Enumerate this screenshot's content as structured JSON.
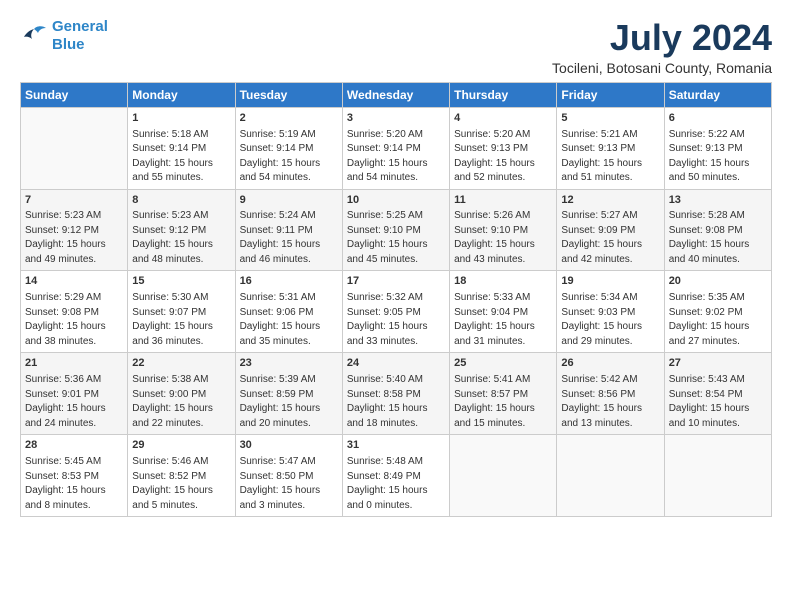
{
  "logo": {
    "line1": "General",
    "line2": "Blue"
  },
  "title": "July 2024",
  "subtitle": "Tocileni, Botosani County, Romania",
  "days_header": [
    "Sunday",
    "Monday",
    "Tuesday",
    "Wednesday",
    "Thursday",
    "Friday",
    "Saturday"
  ],
  "weeks": [
    [
      {
        "day": "",
        "content": ""
      },
      {
        "day": "1",
        "content": "Sunrise: 5:18 AM\nSunset: 9:14 PM\nDaylight: 15 hours\nand 55 minutes."
      },
      {
        "day": "2",
        "content": "Sunrise: 5:19 AM\nSunset: 9:14 PM\nDaylight: 15 hours\nand 54 minutes."
      },
      {
        "day": "3",
        "content": "Sunrise: 5:20 AM\nSunset: 9:14 PM\nDaylight: 15 hours\nand 54 minutes."
      },
      {
        "day": "4",
        "content": "Sunrise: 5:20 AM\nSunset: 9:13 PM\nDaylight: 15 hours\nand 52 minutes."
      },
      {
        "day": "5",
        "content": "Sunrise: 5:21 AM\nSunset: 9:13 PM\nDaylight: 15 hours\nand 51 minutes."
      },
      {
        "day": "6",
        "content": "Sunrise: 5:22 AM\nSunset: 9:13 PM\nDaylight: 15 hours\nand 50 minutes."
      }
    ],
    [
      {
        "day": "7",
        "content": "Sunrise: 5:23 AM\nSunset: 9:12 PM\nDaylight: 15 hours\nand 49 minutes."
      },
      {
        "day": "8",
        "content": "Sunrise: 5:23 AM\nSunset: 9:12 PM\nDaylight: 15 hours\nand 48 minutes."
      },
      {
        "day": "9",
        "content": "Sunrise: 5:24 AM\nSunset: 9:11 PM\nDaylight: 15 hours\nand 46 minutes."
      },
      {
        "day": "10",
        "content": "Sunrise: 5:25 AM\nSunset: 9:10 PM\nDaylight: 15 hours\nand 45 minutes."
      },
      {
        "day": "11",
        "content": "Sunrise: 5:26 AM\nSunset: 9:10 PM\nDaylight: 15 hours\nand 43 minutes."
      },
      {
        "day": "12",
        "content": "Sunrise: 5:27 AM\nSunset: 9:09 PM\nDaylight: 15 hours\nand 42 minutes."
      },
      {
        "day": "13",
        "content": "Sunrise: 5:28 AM\nSunset: 9:08 PM\nDaylight: 15 hours\nand 40 minutes."
      }
    ],
    [
      {
        "day": "14",
        "content": "Sunrise: 5:29 AM\nSunset: 9:08 PM\nDaylight: 15 hours\nand 38 minutes."
      },
      {
        "day": "15",
        "content": "Sunrise: 5:30 AM\nSunset: 9:07 PM\nDaylight: 15 hours\nand 36 minutes."
      },
      {
        "day": "16",
        "content": "Sunrise: 5:31 AM\nSunset: 9:06 PM\nDaylight: 15 hours\nand 35 minutes."
      },
      {
        "day": "17",
        "content": "Sunrise: 5:32 AM\nSunset: 9:05 PM\nDaylight: 15 hours\nand 33 minutes."
      },
      {
        "day": "18",
        "content": "Sunrise: 5:33 AM\nSunset: 9:04 PM\nDaylight: 15 hours\nand 31 minutes."
      },
      {
        "day": "19",
        "content": "Sunrise: 5:34 AM\nSunset: 9:03 PM\nDaylight: 15 hours\nand 29 minutes."
      },
      {
        "day": "20",
        "content": "Sunrise: 5:35 AM\nSunset: 9:02 PM\nDaylight: 15 hours\nand 27 minutes."
      }
    ],
    [
      {
        "day": "21",
        "content": "Sunrise: 5:36 AM\nSunset: 9:01 PM\nDaylight: 15 hours\nand 24 minutes."
      },
      {
        "day": "22",
        "content": "Sunrise: 5:38 AM\nSunset: 9:00 PM\nDaylight: 15 hours\nand 22 minutes."
      },
      {
        "day": "23",
        "content": "Sunrise: 5:39 AM\nSunset: 8:59 PM\nDaylight: 15 hours\nand 20 minutes."
      },
      {
        "day": "24",
        "content": "Sunrise: 5:40 AM\nSunset: 8:58 PM\nDaylight: 15 hours\nand 18 minutes."
      },
      {
        "day": "25",
        "content": "Sunrise: 5:41 AM\nSunset: 8:57 PM\nDaylight: 15 hours\nand 15 minutes."
      },
      {
        "day": "26",
        "content": "Sunrise: 5:42 AM\nSunset: 8:56 PM\nDaylight: 15 hours\nand 13 minutes."
      },
      {
        "day": "27",
        "content": "Sunrise: 5:43 AM\nSunset: 8:54 PM\nDaylight: 15 hours\nand 10 minutes."
      }
    ],
    [
      {
        "day": "28",
        "content": "Sunrise: 5:45 AM\nSunset: 8:53 PM\nDaylight: 15 hours\nand 8 minutes."
      },
      {
        "day": "29",
        "content": "Sunrise: 5:46 AM\nSunset: 8:52 PM\nDaylight: 15 hours\nand 5 minutes."
      },
      {
        "day": "30",
        "content": "Sunrise: 5:47 AM\nSunset: 8:50 PM\nDaylight: 15 hours\nand 3 minutes."
      },
      {
        "day": "31",
        "content": "Sunrise: 5:48 AM\nSunset: 8:49 PM\nDaylight: 15 hours\nand 0 minutes."
      },
      {
        "day": "",
        "content": ""
      },
      {
        "day": "",
        "content": ""
      },
      {
        "day": "",
        "content": ""
      }
    ]
  ]
}
